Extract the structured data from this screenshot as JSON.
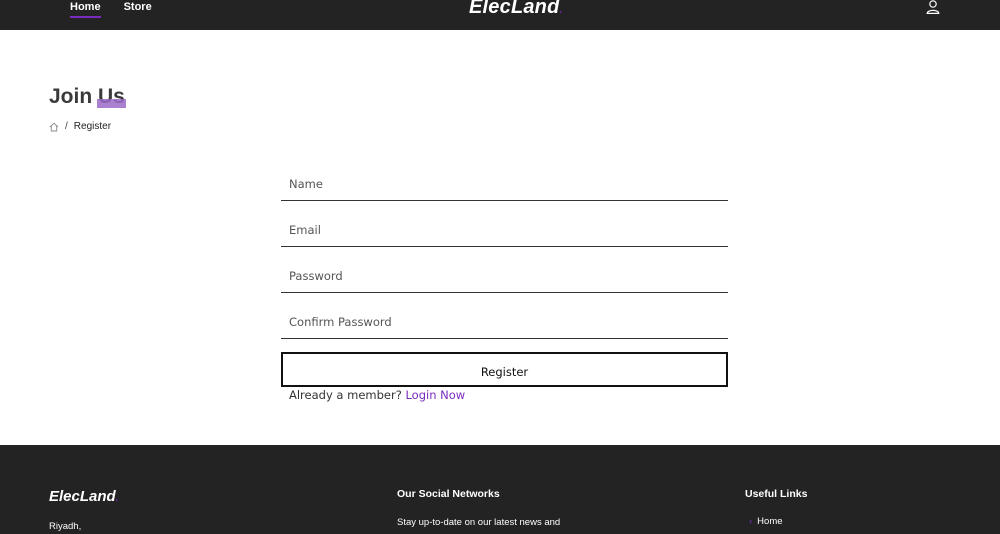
{
  "header": {
    "nav": [
      {
        "label": "Home",
        "active": true
      },
      {
        "label": "Store",
        "active": false
      }
    ],
    "logo": "ElecLand",
    "user_icon": "user-icon"
  },
  "page": {
    "title": "Join Us",
    "breadcrumb": {
      "home_icon": "home-icon",
      "separator": "/",
      "current": "Register"
    }
  },
  "form": {
    "name_placeholder": "Name",
    "email_placeholder": "Email",
    "password_placeholder": "Password",
    "confirm_placeholder": "Confirm Password",
    "submit_label": "Register",
    "member_text": "Already a member?",
    "login_link": "Login Now"
  },
  "footer": {
    "logo": "ElecLand",
    "city": "Riyadh,",
    "social_heading": "Our Social Networks",
    "social_text": "Stay up-to-date on our latest news and",
    "links_heading": "Useful Links",
    "links": [
      "Home"
    ]
  },
  "colors": {
    "accent": "#7a2bbf",
    "dark_bar": "#232323",
    "background": "#ffffff"
  }
}
